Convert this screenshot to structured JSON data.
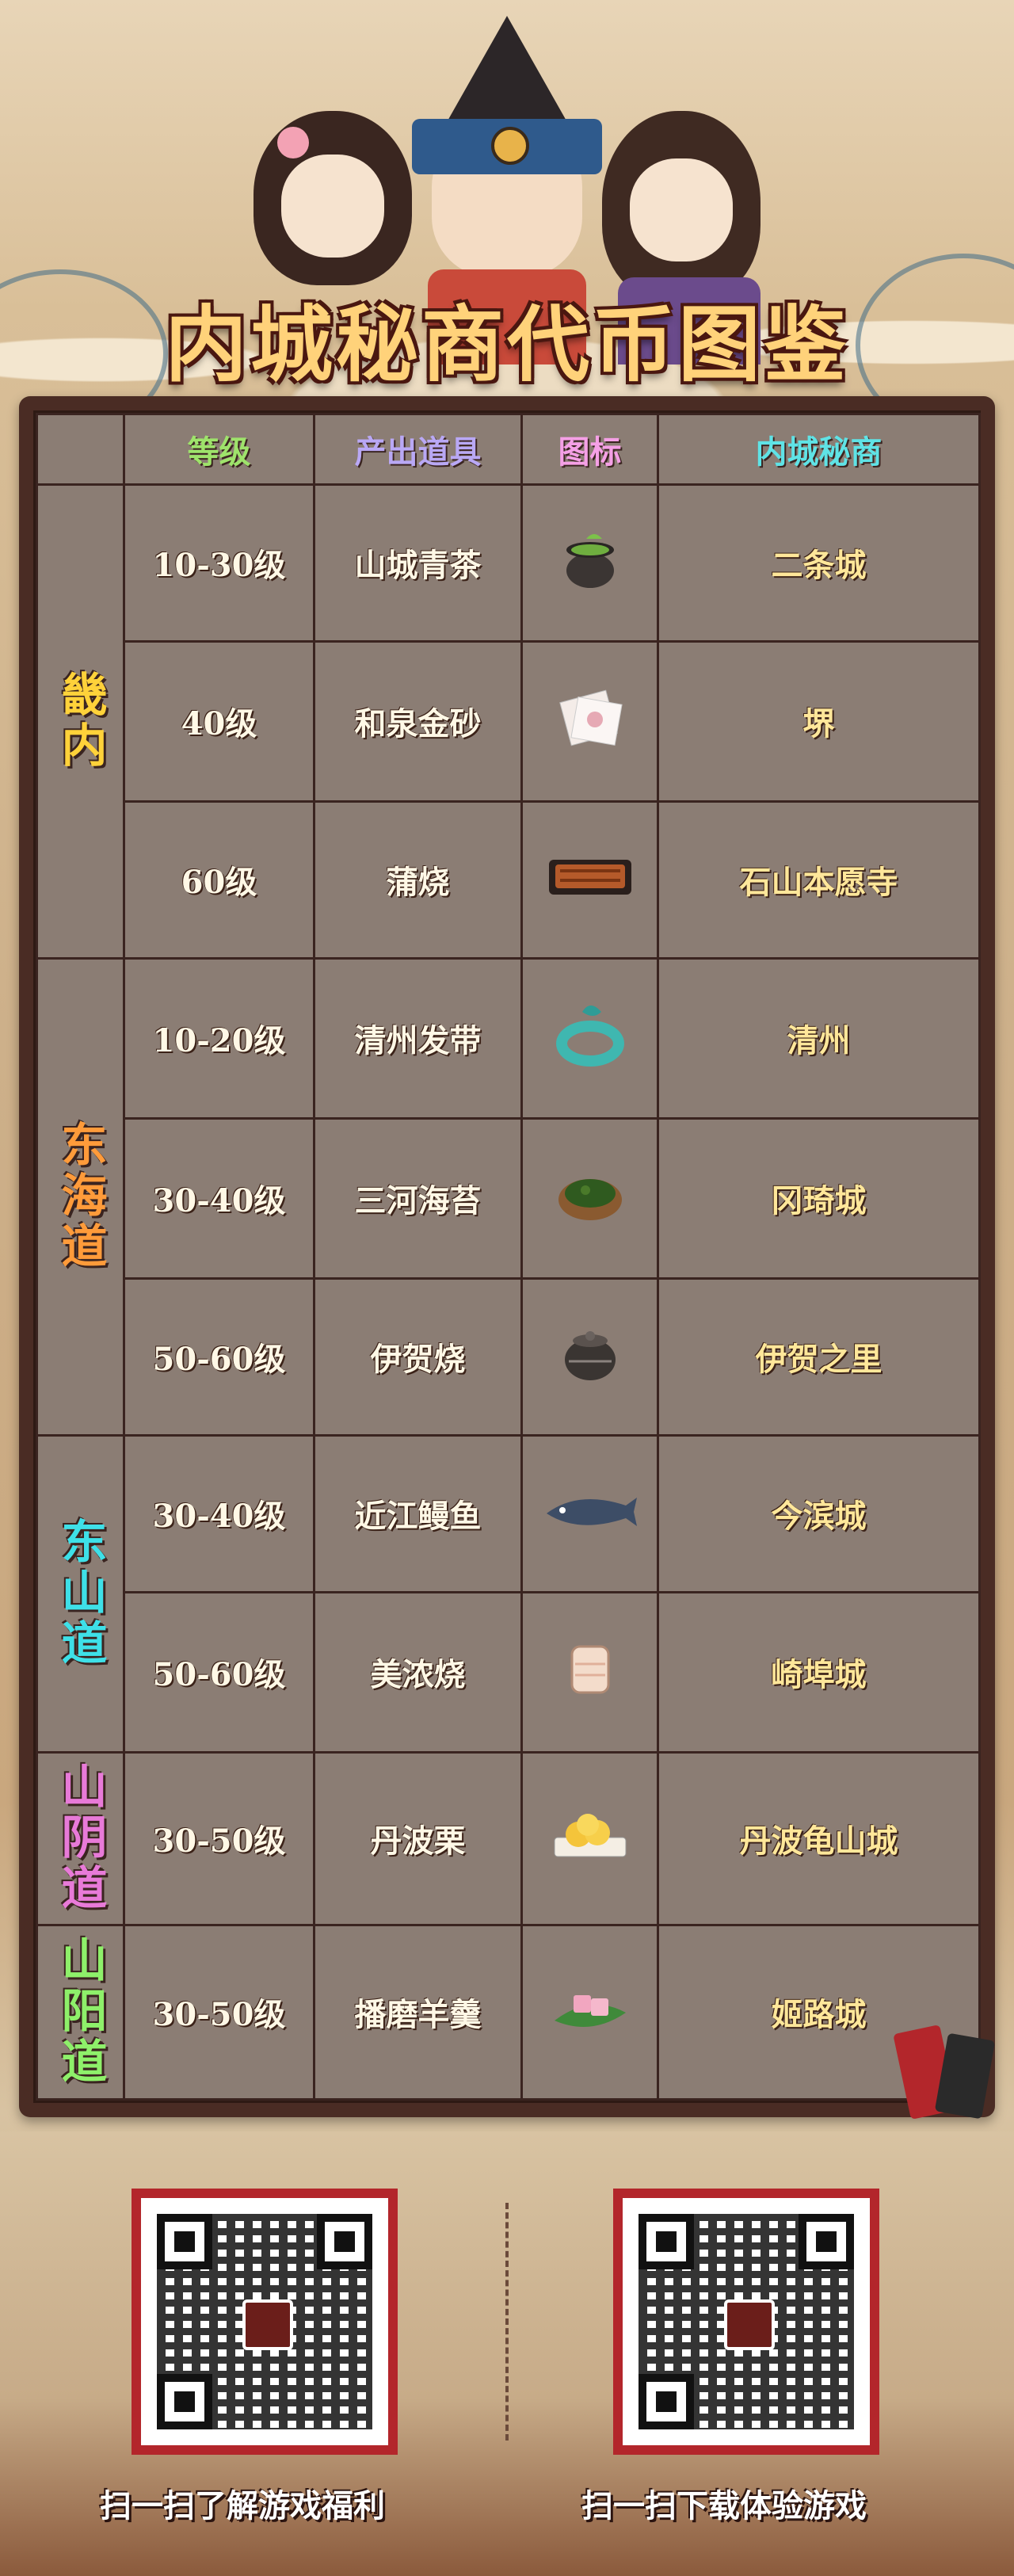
{
  "title": "内城秘商代币图鉴",
  "table": {
    "headers": {
      "level": "等级",
      "item": "产出道具",
      "icon": "图标",
      "merchant": "内城秘商"
    },
    "header_colors": {
      "level": "#9ee36b",
      "item": "#b9a8f5",
      "icon": "#f5a0e6",
      "merchant": "#5fe3e6"
    },
    "regions": [
      {
        "name": "畿内",
        "color": "#ffd23a",
        "rows": [
          {
            "level": "10-30级",
            "item": "山城青茶",
            "icon_name": "tea-bowl-icon",
            "merchant": "二条城"
          },
          {
            "level": "40级",
            "item": "和泉金砂",
            "icon_name": "paper-pouch-icon",
            "merchant": "堺"
          },
          {
            "level": "60级",
            "item": "蒲烧",
            "icon_name": "grilled-eel-icon",
            "merchant": "石山本愿寺"
          }
        ]
      },
      {
        "name": "东海道",
        "color": "#ff9b3a",
        "rows": [
          {
            "level": "10-20级",
            "item": "清州发带",
            "icon_name": "hair-band-icon",
            "merchant": "清州"
          },
          {
            "level": "30-40级",
            "item": "三河海苔",
            "icon_name": "seaweed-bowl-icon",
            "merchant": "冈琦城"
          },
          {
            "level": "50-60级",
            "item": "伊贺烧",
            "icon_name": "pottery-jar-icon",
            "merchant": "伊贺之里"
          }
        ]
      },
      {
        "name": "东山道",
        "color": "#3ee0e8",
        "rows": [
          {
            "level": "30-40级",
            "item": "近江鳗鱼",
            "icon_name": "eel-fish-icon",
            "merchant": "今滨城"
          },
          {
            "level": "50-60级",
            "item": "美浓烧",
            "icon_name": "ceramic-cup-icon",
            "merchant": "崎埠城"
          }
        ]
      },
      {
        "name": "山阴道",
        "color": "#e87ad8",
        "rows": [
          {
            "level": "30-50级",
            "item": "丹波栗",
            "icon_name": "chestnut-plate-icon",
            "merchant": "丹波龟山城"
          }
        ]
      },
      {
        "name": "山阳道",
        "color": "#8ef06a",
        "rows": [
          {
            "level": "30-50级",
            "item": "播磨羊羹",
            "icon_name": "yokan-sweet-icon",
            "merchant": "姬路城"
          }
        ]
      }
    ]
  },
  "footer": {
    "left_caption": "扫一扫了解游戏福利",
    "right_caption": "扫一扫下载体验游戏"
  }
}
